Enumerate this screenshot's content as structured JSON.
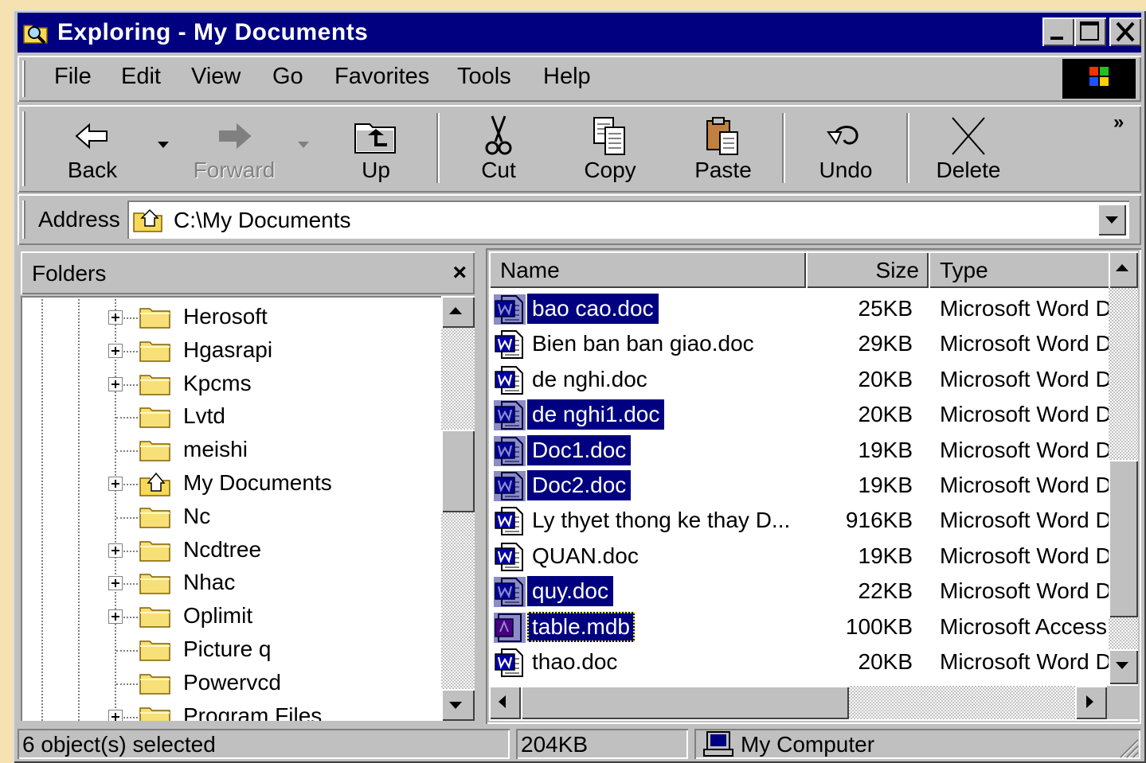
{
  "window": {
    "title": "Exploring - My Documents"
  },
  "menu": [
    "File",
    "Edit",
    "View",
    "Go",
    "Favorites",
    "Tools",
    "Help"
  ],
  "toolbar": {
    "back": "Back",
    "forward": "Forward",
    "up": "Up",
    "cut": "Cut",
    "copy": "Copy",
    "paste": "Paste",
    "undo": "Undo",
    "delete": "Delete",
    "more": "»"
  },
  "address": {
    "label": "Address",
    "value": "C:\\My Documents"
  },
  "folders": {
    "title": "Folders",
    "close": "×",
    "items": [
      {
        "label": "Herosoft",
        "expandable": true
      },
      {
        "label": "Hgasrapi",
        "expandable": true
      },
      {
        "label": "Kpcms",
        "expandable": true
      },
      {
        "label": "Lvtd",
        "expandable": false
      },
      {
        "label": "meishi",
        "expandable": false
      },
      {
        "label": "My Documents",
        "expandable": true
      },
      {
        "label": "Nc",
        "expandable": false
      },
      {
        "label": "Ncdtree",
        "expandable": true
      },
      {
        "label": "Nhac",
        "expandable": true
      },
      {
        "label": "Oplimit",
        "expandable": true
      },
      {
        "label": "Picture q",
        "expandable": false
      },
      {
        "label": "Powervcd",
        "expandable": false
      },
      {
        "label": "Program Files",
        "expandable": true
      }
    ]
  },
  "files": {
    "columns": {
      "name": "Name",
      "size": "Size",
      "type": "Type"
    },
    "rows": [
      {
        "name": "bao cao.doc",
        "size": "25KB",
        "type": "Microsoft Word D",
        "selected": true,
        "icon": "word-doc-icon"
      },
      {
        "name": "Bien ban ban giao.doc",
        "size": "29KB",
        "type": "Microsoft Word D",
        "selected": false,
        "icon": "word-doc-icon"
      },
      {
        "name": "de nghi.doc",
        "size": "20KB",
        "type": "Microsoft Word D",
        "selected": false,
        "icon": "word-doc-icon"
      },
      {
        "name": "de nghi1.doc",
        "size": "20KB",
        "type": "Microsoft Word D",
        "selected": true,
        "icon": "word-doc-icon"
      },
      {
        "name": "Doc1.doc",
        "size": "19KB",
        "type": "Microsoft Word D",
        "selected": true,
        "icon": "word-doc-icon"
      },
      {
        "name": "Doc2.doc",
        "size": "19KB",
        "type": "Microsoft Word D",
        "selected": true,
        "icon": "word-doc-icon"
      },
      {
        "name": "Ly thyet thong ke thay D...",
        "size": "916KB",
        "type": "Microsoft Word D",
        "selected": false,
        "icon": "word-doc-icon"
      },
      {
        "name": "QUAN.doc",
        "size": "19KB",
        "type": "Microsoft Word D",
        "selected": false,
        "icon": "word-doc-icon"
      },
      {
        "name": "quy.doc",
        "size": "22KB",
        "type": "Microsoft Word D",
        "selected": true,
        "icon": "word-doc-icon"
      },
      {
        "name": "table.mdb",
        "size": "100KB",
        "type": "Microsoft Access",
        "selected": true,
        "focused": true,
        "icon": "access-db-icon"
      },
      {
        "name": "thao.doc",
        "size": "20KB",
        "type": "Microsoft Word D",
        "selected": false,
        "icon": "word-doc-icon"
      }
    ]
  },
  "status": {
    "selection": "6 object(s) selected",
    "size": "204KB",
    "location": "My Computer"
  },
  "colors": {
    "titlebar": "#000080",
    "selection": "#000080",
    "face": "#c0c0c0",
    "desktop": "#f6e2b0"
  }
}
